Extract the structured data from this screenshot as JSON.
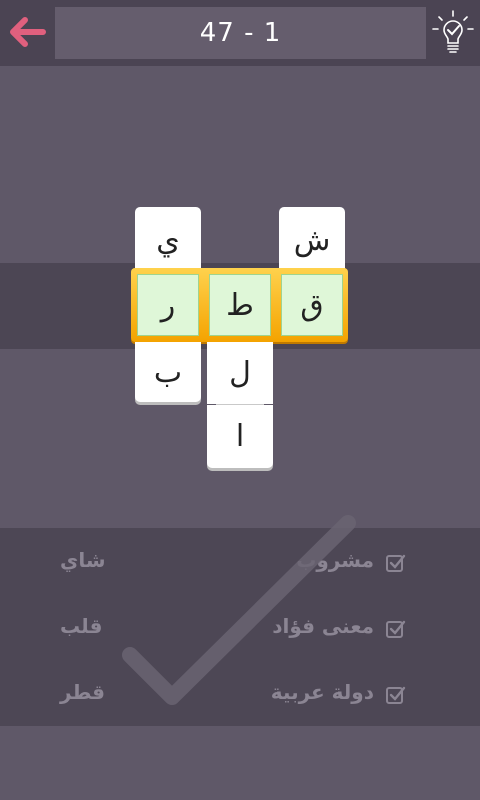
{
  "header": {
    "title": "47 - 1",
    "back_icon": "arrow-left-icon",
    "hint_icon": "lightbulb-check-icon"
  },
  "board": {
    "column1": {
      "top": "ي",
      "row": "ر",
      "bottom": "ب"
    },
    "column2": {
      "row": "ط",
      "below1": "ل",
      "below2": "ا"
    },
    "column3": {
      "top": "ش",
      "row": "ق"
    }
  },
  "clues": [
    {
      "clue": "مشروب",
      "answer": "شاي",
      "solved": true
    },
    {
      "clue": "معنى فؤاد",
      "answer": "قلب",
      "solved": true
    },
    {
      "clue": "دولة عربية",
      "answer": "قطر",
      "solved": true
    }
  ],
  "colors": {
    "accent": "#e0607e",
    "highlight_frame": "#f4a300",
    "solved_tile": "#dff7d8"
  }
}
